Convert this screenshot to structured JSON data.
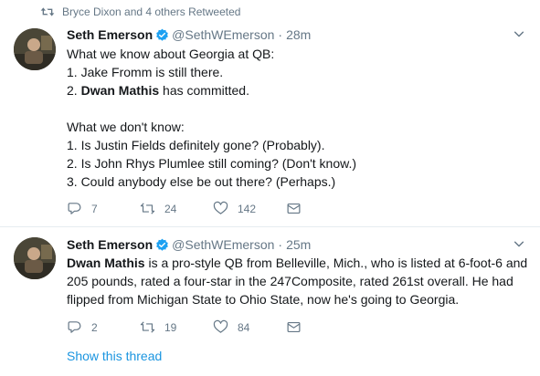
{
  "colors": {
    "primary_text": "#14171a",
    "secondary_text": "#657786",
    "link": "#1b95e0",
    "verified": "#1da1f2",
    "divider": "#e6ecf0"
  },
  "tweets": [
    {
      "retweet_context": "Bryce Dixon and 4 others Retweeted",
      "author_name": "Seth Emerson",
      "handle": "@SethWEmerson",
      "separator": "·",
      "time": "28m",
      "verified_icon": "verified-badge-icon",
      "lines": [
        {
          "type": "text",
          "text": "What we know about Georgia at QB:"
        },
        {
          "type": "text",
          "text": "1. Jake Fromm is still there."
        },
        {
          "type": "mixed",
          "prefix": "2. ",
          "bold": "Dwan Mathis",
          "suffix": " has committed."
        },
        {
          "type": "blank"
        },
        {
          "type": "text",
          "text": "What we don't know:"
        },
        {
          "type": "text",
          "text": "1. Is Justin Fields definitely gone? (Probably)."
        },
        {
          "type": "text",
          "text": "2. Is John Rhys Plumlee still coming? (Don't know.)"
        },
        {
          "type": "text",
          "text": "3. Could anybody else be out there? (Perhaps.)"
        }
      ],
      "actions": {
        "replies": "7",
        "retweets": "24",
        "likes": "142"
      }
    },
    {
      "author_name": "Seth Emerson",
      "handle": "@SethWEmerson",
      "separator": "·",
      "time": "25m",
      "verified_icon": "verified-badge-icon",
      "text_bold": "Dwan Mathis",
      "text_line1": " is a pro-style QB from Belleville, Mich., who is listed at 6-foot-6 and",
      "text_line2": "205 pounds, rated a four-star in the 247Composite, rated 261st overall. He had",
      "text_line3": "flipped from Michigan State to Ohio State, now he's going to Georgia.",
      "actions": {
        "replies": "2",
        "retweets": "19",
        "likes": "84"
      },
      "show_thread": "Show this thread"
    }
  ]
}
